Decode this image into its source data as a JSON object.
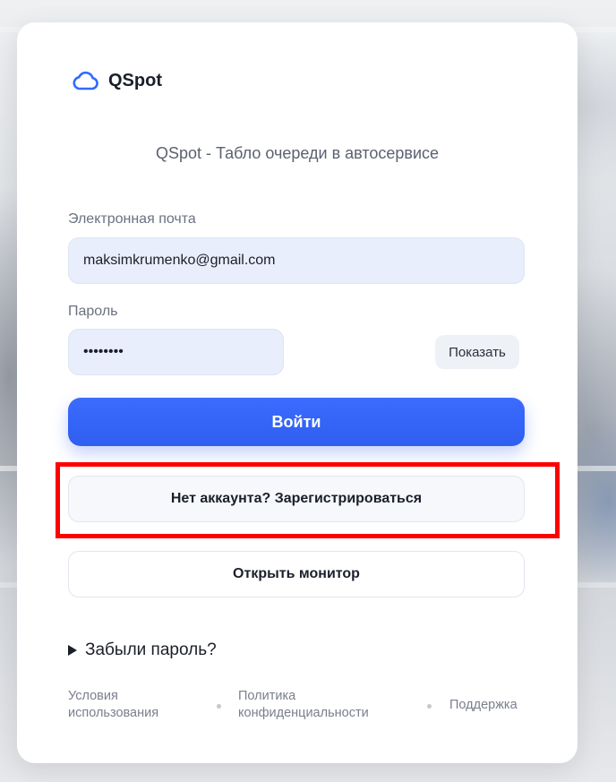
{
  "brand": {
    "name": "QSpot",
    "logo_icon": "cloud-icon",
    "accent_color": "#2f5ef0"
  },
  "subtitle": "QSpot - Табло очереди в автосервисе",
  "form": {
    "email_label": "Электронная почта",
    "email_value": "maksimkrumenko@gmail.com",
    "password_label": "Пароль",
    "password_value": "********",
    "show_button": "Показать"
  },
  "buttons": {
    "login": "Войти",
    "register": "Нет аккаунта? Зарегистрироваться",
    "monitor": "Открыть монитор"
  },
  "forgot_password": "Забыли пароль?",
  "footer": {
    "terms_line1": "Условия",
    "terms_line2": "использования",
    "privacy_line1": "Политика",
    "privacy_line2": "конфиденциальности",
    "support": "Поддержка"
  },
  "annotation": {
    "highlight_color": "#ff0000"
  }
}
